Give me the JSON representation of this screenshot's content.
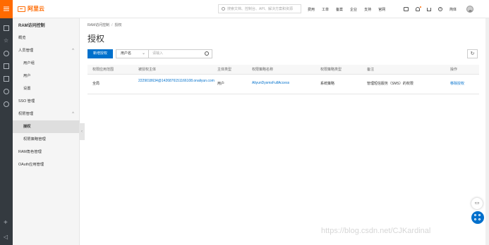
{
  "brand": {
    "name": "阿里云",
    "accent": "#ff6a00",
    "primary": "#0070cc"
  },
  "search": {
    "placeholder": "搜索文档、控制台、API、解决方案和资源"
  },
  "topnav": [
    "费用",
    "工单",
    "备案",
    "企业",
    "支持",
    "官网"
  ],
  "lang": "简体",
  "sidebar": {
    "title": "RAM访问控制",
    "items": [
      {
        "label": "概览"
      },
      {
        "label": "人员管理"
      },
      {
        "label": "用户组"
      },
      {
        "label": "用户"
      },
      {
        "label": "设置"
      },
      {
        "label": "SSO 管理"
      },
      {
        "label": "权限管理"
      },
      {
        "label": "授权"
      },
      {
        "label": "权限策略管理"
      },
      {
        "label": "RAM角色管理"
      },
      {
        "label": "OAuth应用管理"
      }
    ]
  },
  "breadcrumb": [
    "RAM访问控制",
    "授权"
  ],
  "page_title": "授权",
  "toolbar": {
    "add_label": "新增授权",
    "filter_select": "用户名",
    "search_placeholder": "请输入"
  },
  "table": {
    "headers": [
      "权限应用范围",
      "被授权主体",
      "主体类型",
      "权限策略名称",
      "权限策略类型",
      "备注",
      "操作"
    ],
    "rows": [
      {
        "scope": "全局",
        "principal": "2229018634@1426876151166108.onaliyun.com",
        "type": "用户",
        "policy": "AliyunDysmsFullAccess",
        "policy_type": "系统策略",
        "note": "管理短信服务（SMS）的权限",
        "action": "移除授权"
      }
    ]
  },
  "watermark": "https://blog.csdn.net/CJKardinal"
}
